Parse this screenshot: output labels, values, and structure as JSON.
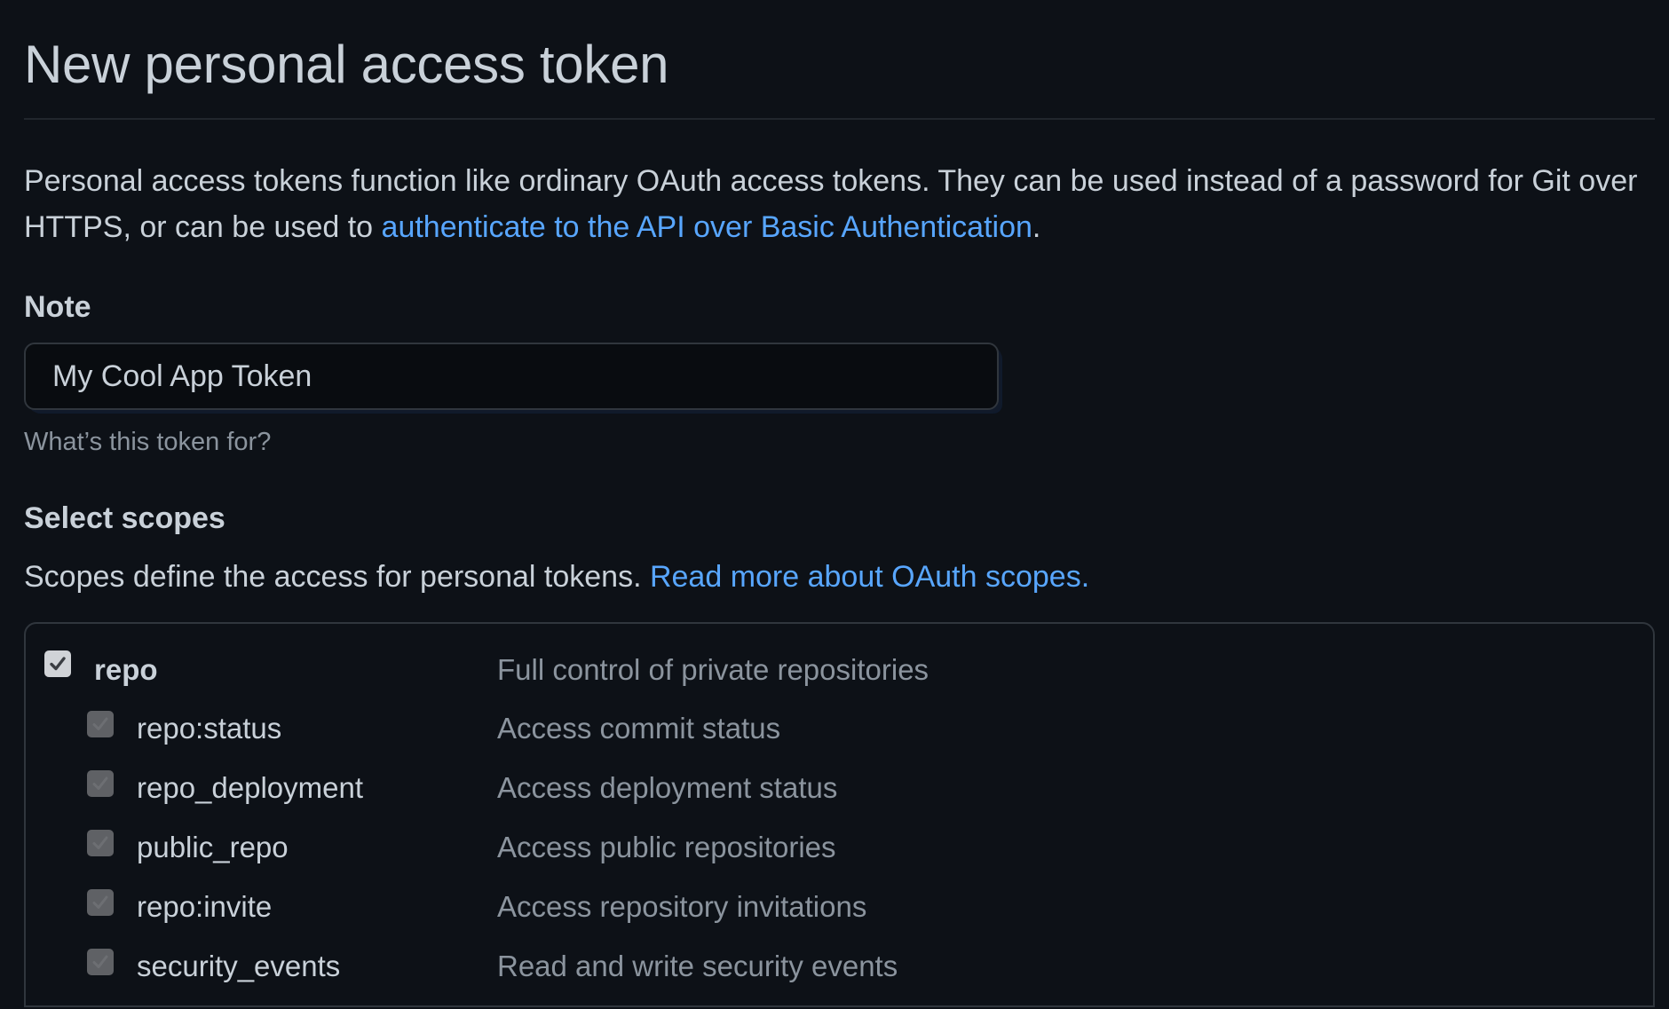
{
  "page": {
    "title": "New personal access token",
    "intro_text": "Personal access tokens function like ordinary OAuth access tokens. They can be used instead of a password for Git over HTTPS, or can be used to ",
    "intro_link": "authenticate to the API over Basic Authentication",
    "intro_suffix": "."
  },
  "note": {
    "label": "Note",
    "value": "My Cool App Token",
    "hint": "What’s this token for?"
  },
  "scopes": {
    "label": "Select scopes",
    "description": "Scopes define the access for personal tokens. ",
    "link": "Read more about OAuth scopes.",
    "items": [
      {
        "name": "repo",
        "description": "Full control of private repositories",
        "checked": true,
        "level": "parent"
      },
      {
        "name": "repo:status",
        "description": "Access commit status",
        "checked": true,
        "level": "child"
      },
      {
        "name": "repo_deployment",
        "description": "Access deployment status",
        "checked": true,
        "level": "child"
      },
      {
        "name": "public_repo",
        "description": "Access public repositories",
        "checked": true,
        "level": "child"
      },
      {
        "name": "repo:invite",
        "description": "Access repository invitations",
        "checked": true,
        "level": "child"
      },
      {
        "name": "security_events",
        "description": "Read and write security events",
        "checked": true,
        "level": "child"
      }
    ]
  },
  "colors": {
    "background": "#0d1117",
    "text": "#c9d1d9",
    "muted": "#8b949e",
    "link": "#58a6ff",
    "border": "#30363d"
  }
}
